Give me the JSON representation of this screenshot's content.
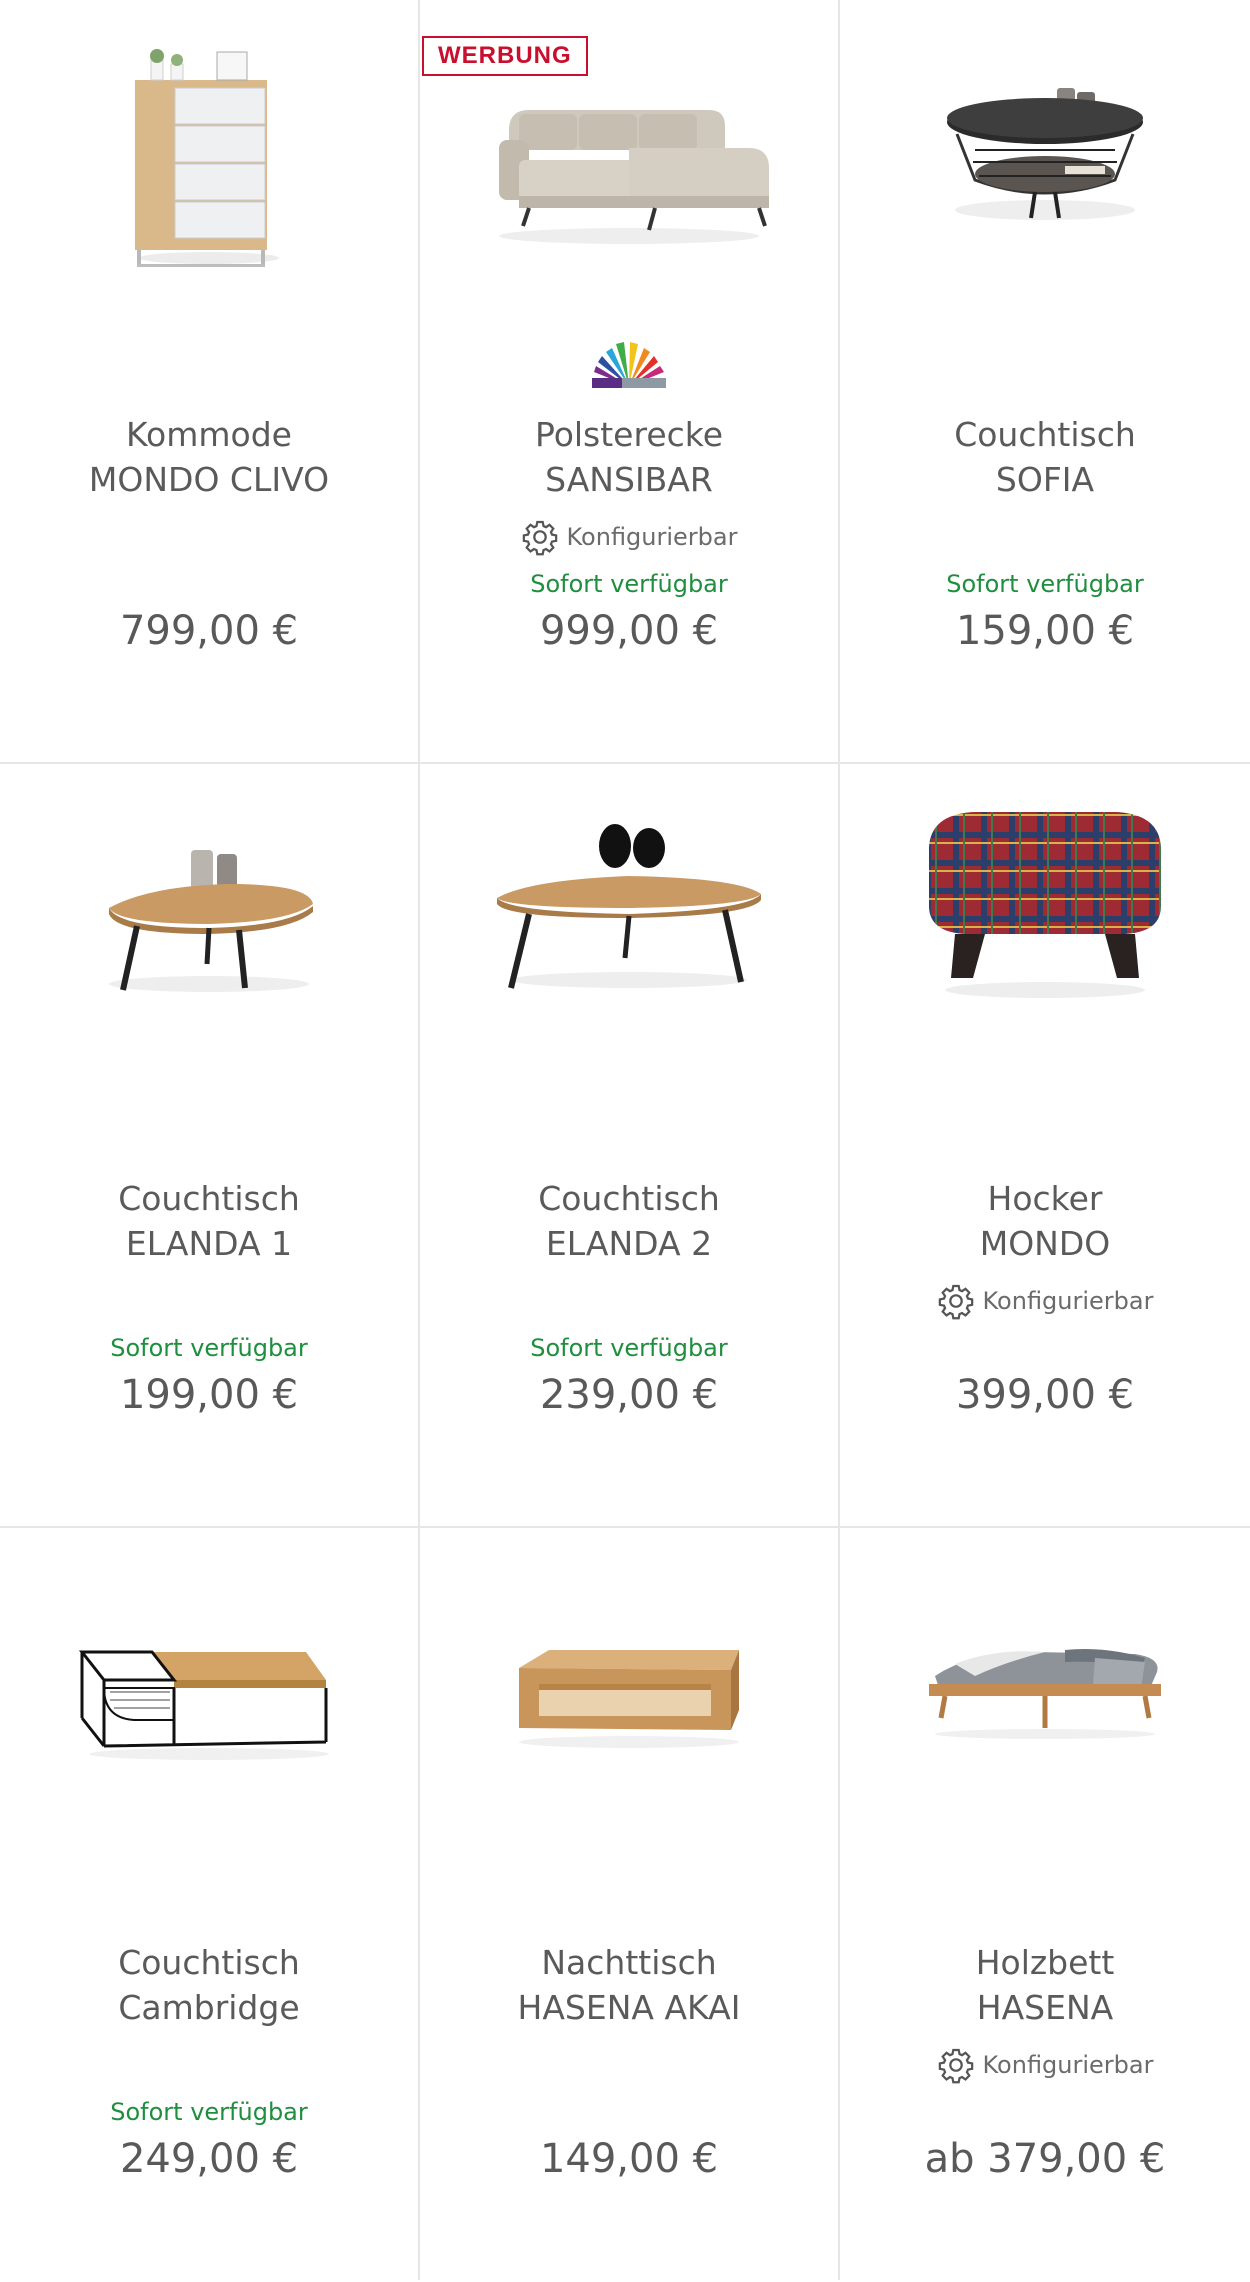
{
  "products": [
    {
      "line1": "Kommode",
      "line2": "MONDO CLIVO",
      "config": "",
      "availability": "",
      "price": "799,00 €",
      "image_icon": "dresser-image"
    },
    {
      "line1": "Polsterecke",
      "line2": "SANSIBAR",
      "config": "Konfigurierbar",
      "availability": "Sofort verfügbar",
      "price": "999,00 €",
      "badge": "WERBUNG",
      "image_icon": "sofa-image",
      "logo_icon": "color-fan-logo"
    },
    {
      "line1": "Couchtisch",
      "line2": "SOFIA",
      "config": "",
      "availability": "Sofort verfügbar",
      "price": "159,00 €",
      "image_icon": "round-coffee-table-image"
    },
    {
      "line1": "Couchtisch",
      "line2": "ELANDA 1",
      "config": "",
      "availability": "Sofort verfügbar",
      "price": "199,00 €",
      "image_icon": "oval-coffee-table-image"
    },
    {
      "line1": "Couchtisch",
      "line2": "ELANDA 2",
      "config": "",
      "availability": "Sofort verfügbar",
      "price": "239,00 €",
      "image_icon": "triangle-coffee-table-image"
    },
    {
      "line1": "Hocker",
      "line2": "MONDO",
      "config": "Konfigurierbar",
      "availability": "",
      "price": "399,00 €",
      "image_icon": "plaid-stool-image"
    },
    {
      "line1": "Couchtisch",
      "line2": "Cambridge",
      "config": "",
      "availability": "Sofort verfügbar",
      "price": "249,00 €",
      "image_icon": "metal-frame-table-image"
    },
    {
      "line1": "Nachttisch",
      "line2": "HASENA AKAI",
      "config": "",
      "availability": "",
      "price": "149,00 €",
      "image_icon": "wood-box-nightstand-image"
    },
    {
      "line1": "Holzbett",
      "line2": "HASENA",
      "config": "Konfigurierbar",
      "availability": "",
      "price": "ab 379,00 €",
      "image_icon": "wooden-bed-image"
    }
  ],
  "colors": {
    "availability": "#1f8f3f",
    "badge": "#c8102e",
    "divider": "#e6e6e6",
    "text": "#5a5a5a"
  }
}
